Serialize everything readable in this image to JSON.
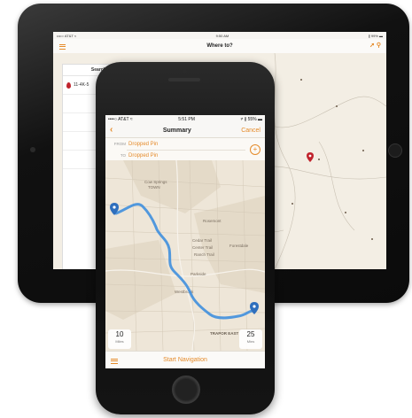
{
  "colors": {
    "accent": "#e58b2a",
    "route": "#3f8fde",
    "pin_blue": "#2f6fbd",
    "pin_red": "#c0232c"
  },
  "ipad": {
    "status": {
      "left": "••••○ AT&T ≈",
      "center": "9:50 AM",
      "right": "∦ 99% ▬"
    },
    "nav": {
      "title": "Where to?",
      "menu_icon": "hamburger-icon",
      "location_icon": "location-arrow-icon",
      "search_icon": "search-icon"
    },
    "search_panel": {
      "title": "Search Results",
      "first_result": "11-4K-5"
    }
  },
  "iphone": {
    "status": {
      "left": "••••○ AT&T ≈",
      "center": "5:51 PM",
      "right": "≠ ∦ 55% ▬"
    },
    "nav": {
      "back_icon": "chevron-left-icon",
      "title": "Summary",
      "cancel_label": "Cancel"
    },
    "route": {
      "from_label": "FROM",
      "from_value": "Dropped Pin",
      "to_label": "TO",
      "to_value": "Dropped Pin",
      "add_icon": "plus-circle-icon"
    },
    "map": {
      "place_labels": [
        "Cow Springs",
        "TOWN",
        "Rosemont",
        "Cedar Trail",
        "Center Trail",
        "Ranch Trail",
        "Forestdale",
        "Parkside",
        "Westbrook",
        "TRAPOR EAST"
      ]
    },
    "distance": {
      "value": "10",
      "unit": "Miles"
    },
    "duration": {
      "value": "25",
      "unit": "Mins"
    },
    "bottom": {
      "list_icon": "list-icon",
      "start_label": "Start Navigation"
    }
  }
}
